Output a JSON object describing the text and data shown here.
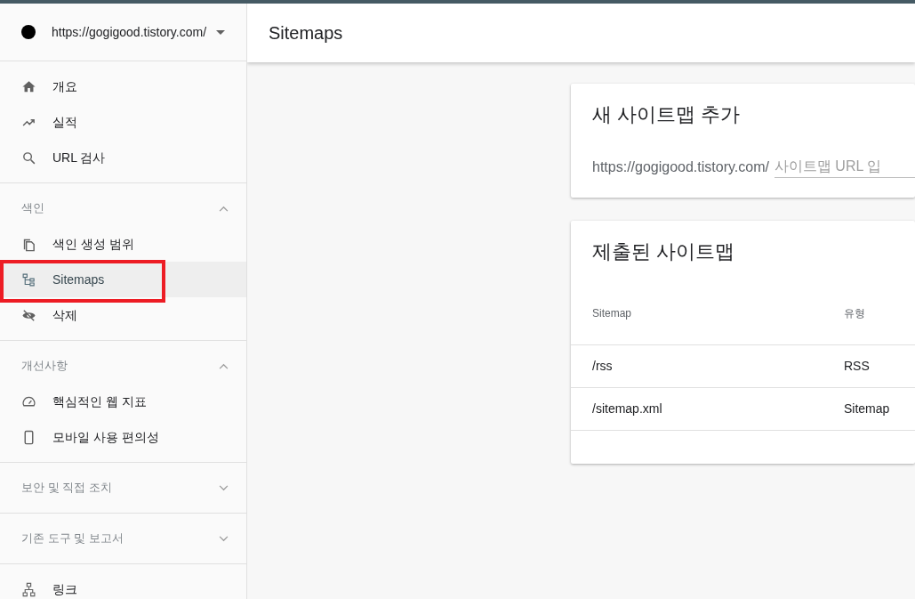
{
  "sidebar": {
    "property": {
      "url": "https://gogigood.tistory.com/"
    },
    "sections": [
      {
        "items": [
          {
            "label": "개요",
            "selected": false,
            "highlighted": false
          },
          {
            "label": "실적",
            "selected": false,
            "highlighted": false
          },
          {
            "label": "URL 검사",
            "selected": false,
            "highlighted": false
          }
        ]
      },
      {
        "title": "색인",
        "expanded": true,
        "items": [
          {
            "label": "색인 생성 범위",
            "selected": false,
            "highlighted": false
          },
          {
            "label": "Sitemaps",
            "selected": true,
            "highlighted": true
          },
          {
            "label": "삭제",
            "selected": false,
            "highlighted": false
          }
        ]
      },
      {
        "title": "개선사항",
        "expanded": true,
        "items": [
          {
            "label": "핵심적인 웹 지표",
            "selected": false,
            "highlighted": false
          },
          {
            "label": "모바일 사용 편의성",
            "selected": false,
            "highlighted": false
          }
        ]
      },
      {
        "title": "보안 및 직접 조치",
        "expanded": false
      },
      {
        "title": "기존 도구 및 보고서",
        "expanded": false
      },
      {
        "items": [
          {
            "label": "링크",
            "selected": false,
            "highlighted": false
          }
        ]
      }
    ]
  },
  "header": {
    "title": "Sitemaps"
  },
  "add_card": {
    "title": "새 사이트맵 추가",
    "prefix": "https://gogigood.tistory.com/",
    "placeholder": "사이트맵 URL 입"
  },
  "submitted_card": {
    "title": "제출된 사이트맵",
    "table": {
      "columns": [
        "Sitemap",
        "유형"
      ],
      "rows": [
        [
          "/rss",
          "RSS"
        ],
        [
          "/sitemap.xml",
          "Sitemap"
        ]
      ]
    }
  }
}
